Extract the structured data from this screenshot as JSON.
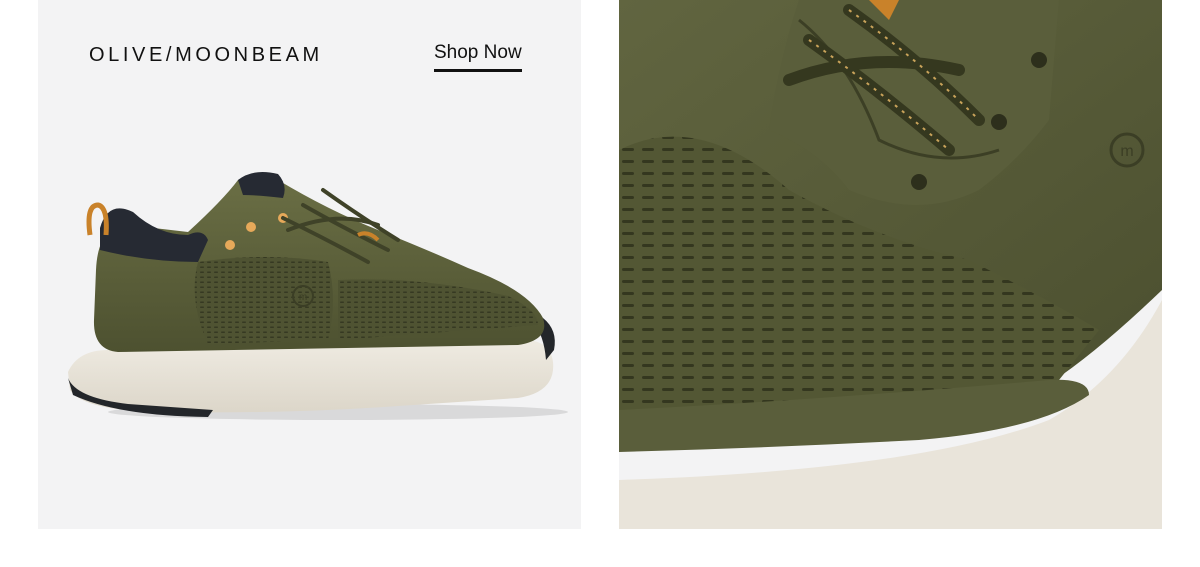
{
  "left_panel": {
    "colorway": "OLIVE/MOONBEAM",
    "shop_now_label": "Shop Now",
    "image_alt": "Olive/Moonbeam sneaker side view"
  },
  "right_panel": {
    "image_alt": "Olive/Moonbeam sneaker close-up detail"
  },
  "colors": {
    "panel_bg": "#f3f3f4",
    "olive": "#5b5f3a",
    "sole": "#e8e3d8",
    "accent_orange": "#d18a2a"
  }
}
